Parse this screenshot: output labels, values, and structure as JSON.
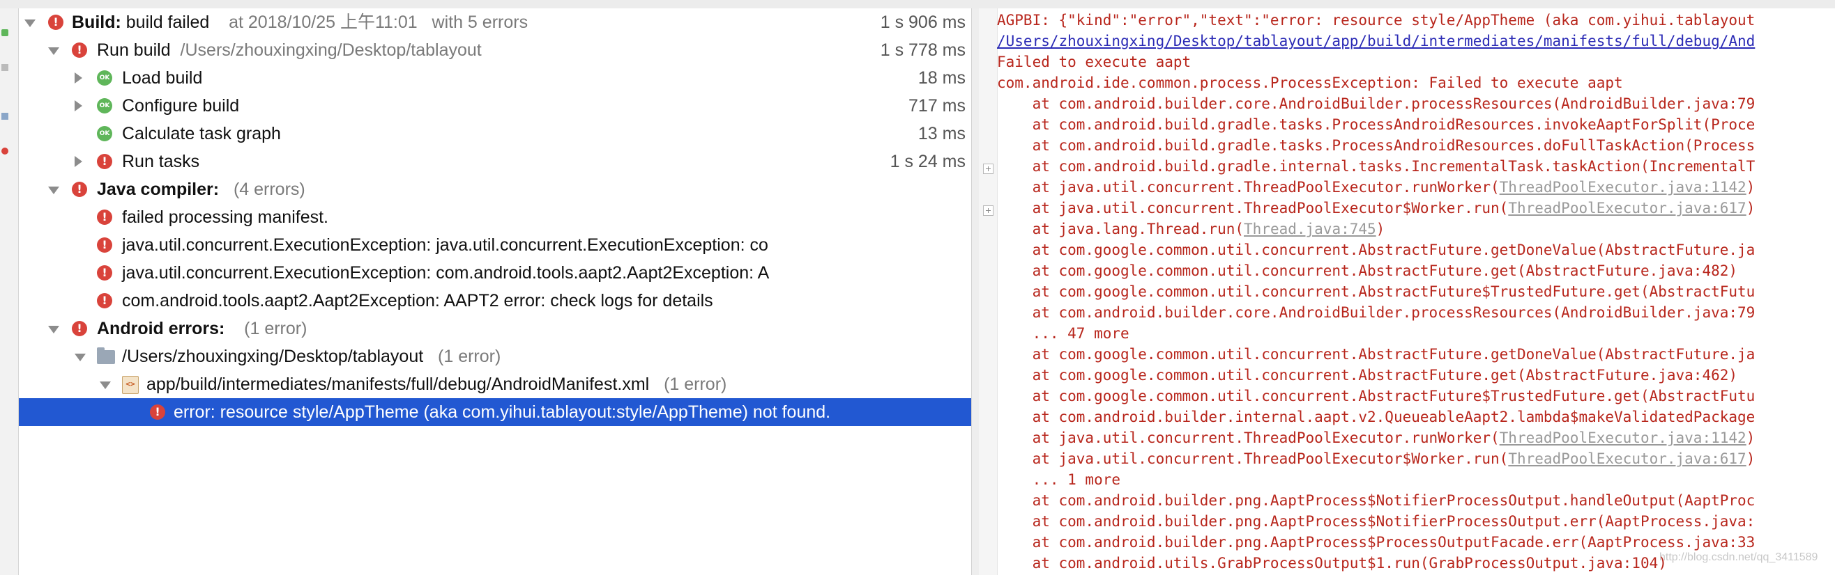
{
  "build_tree": {
    "root": {
      "title": "Build:",
      "status": "build failed",
      "time": "at 2018/10/25 上午11:01",
      "errors": "with 5 errors",
      "duration": "1 s 906 ms"
    },
    "run_build": {
      "title": "Run build",
      "path": "/Users/zhouxingxing/Desktop/tablayout",
      "duration": "1 s 778 ms"
    },
    "load_build": {
      "label": "Load build",
      "duration": "18 ms"
    },
    "configure_build": {
      "label": "Configure build",
      "duration": "717 ms"
    },
    "calc_graph": {
      "label": "Calculate task graph",
      "duration": "13 ms"
    },
    "run_tasks": {
      "label": "Run tasks",
      "duration": "1 s 24 ms"
    },
    "java_compiler": {
      "title": "Java compiler:",
      "count": "(4 errors)"
    },
    "java_errors": [
      "failed processing manifest.",
      "java.util.concurrent.ExecutionException: java.util.concurrent.ExecutionException: co",
      "java.util.concurrent.ExecutionException: com.android.tools.aapt2.Aapt2Exception: A",
      "com.android.tools.aapt2.Aapt2Exception: AAPT2 error: check logs for details"
    ],
    "android_errors": {
      "title": "Android errors:",
      "count": "(1 error)"
    },
    "project_folder": {
      "path": "/Users/zhouxingxing/Desktop/tablayout",
      "count": "(1 error)"
    },
    "manifest_file": {
      "path": "app/build/intermediates/manifests/full/debug/AndroidManifest.xml",
      "count": "(1 error)"
    },
    "selected_error": "error: resource style/AppTheme (aka com.yihui.tablayout:style/AppTheme) not found."
  },
  "console": {
    "line0": "AGPBI: {\"kind\":\"error\",\"text\":\"error: resource style/AppTheme (aka com.yihui.tablayout",
    "line1_link": "/Users/zhouxingxing/Desktop/tablayout/app/build/intermediates/manifests/full/debug/And",
    "line2": "Failed to execute aapt",
    "line3": "com.android.ide.common.process.ProcessException: Failed to execute aapt",
    "line4": "    at com.android.builder.core.AndroidBuilder.processResources(AndroidBuilder.java:79",
    "line5": "    at com.android.build.gradle.tasks.ProcessAndroidResources.invokeAaptForSplit(Proce",
    "line6": "    at com.android.build.gradle.tasks.ProcessAndroidResources.doFullTaskAction(Process",
    "line7": "    at com.android.build.gradle.internal.tasks.IncrementalTask.taskAction(IncrementalT",
    "line8_pre": "    at java.util.concurrent.ThreadPoolExecutor.runWorker(",
    "line8_src": "ThreadPoolExecutor.java:1142",
    "line8_post": ")",
    "line9_pre": "    at java.util.concurrent.ThreadPoolExecutor$Worker.run(",
    "line9_src": "ThreadPoolExecutor.java:617",
    "line9_post": ")",
    "line10_pre": "    at java.lang.Thread.run(",
    "line10_src": "Thread.java:745",
    "line10_post": ")",
    "line11": "    at com.google.common.util.concurrent.AbstractFuture.getDoneValue(AbstractFuture.ja",
    "line12": "    at com.google.common.util.concurrent.AbstractFuture.get(AbstractFuture.java:482)",
    "line13": "    at com.google.common.util.concurrent.AbstractFuture$TrustedFuture.get(AbstractFutu",
    "line14": "    at com.android.builder.core.AndroidBuilder.processResources(AndroidBuilder.java:79",
    "line15": "    ... 47 more",
    "line16": "    at com.google.common.util.concurrent.AbstractFuture.getDoneValue(AbstractFuture.ja",
    "line17": "    at com.google.common.util.concurrent.AbstractFuture.get(AbstractFuture.java:462)",
    "line18": "    at com.google.common.util.concurrent.AbstractFuture$TrustedFuture.get(AbstractFutu",
    "line19": "    at com.android.builder.internal.aapt.v2.QueueableAapt2.lambda$makeValidatedPackage",
    "line20_pre": "    at java.util.concurrent.ThreadPoolExecutor.runWorker(",
    "line20_src": "ThreadPoolExecutor.java:1142",
    "line20_post": ")",
    "line21_pre": "    at java.util.concurrent.ThreadPoolExecutor$Worker.run(",
    "line21_src": "ThreadPoolExecutor.java:617",
    "line21_post": ")",
    "line22": "    ... 1 more",
    "line23": "    at com.android.builder.png.AaptProcess$NotifierProcessOutput.handleOutput(AaptProc",
    "line24": "    at com.android.builder.png.AaptProcess$NotifierProcessOutput.err(AaptProcess.java:",
    "line25": "    at com.android.builder.png.AaptProcess$ProcessOutputFacade.err(AaptProcess.java:33",
    "line26": "    at com.android.utils.GrabProcessOutput$1.run(GrabProcessOutput.java:104)"
  },
  "watermark": "http://blog.csdn.net/qq_3411589",
  "colors": {
    "selection": "#2258d2",
    "error_text": "#b8261c",
    "link": "#2a2ab5",
    "error_icon": "#d9433b",
    "ok_icon": "#5fb65a"
  }
}
